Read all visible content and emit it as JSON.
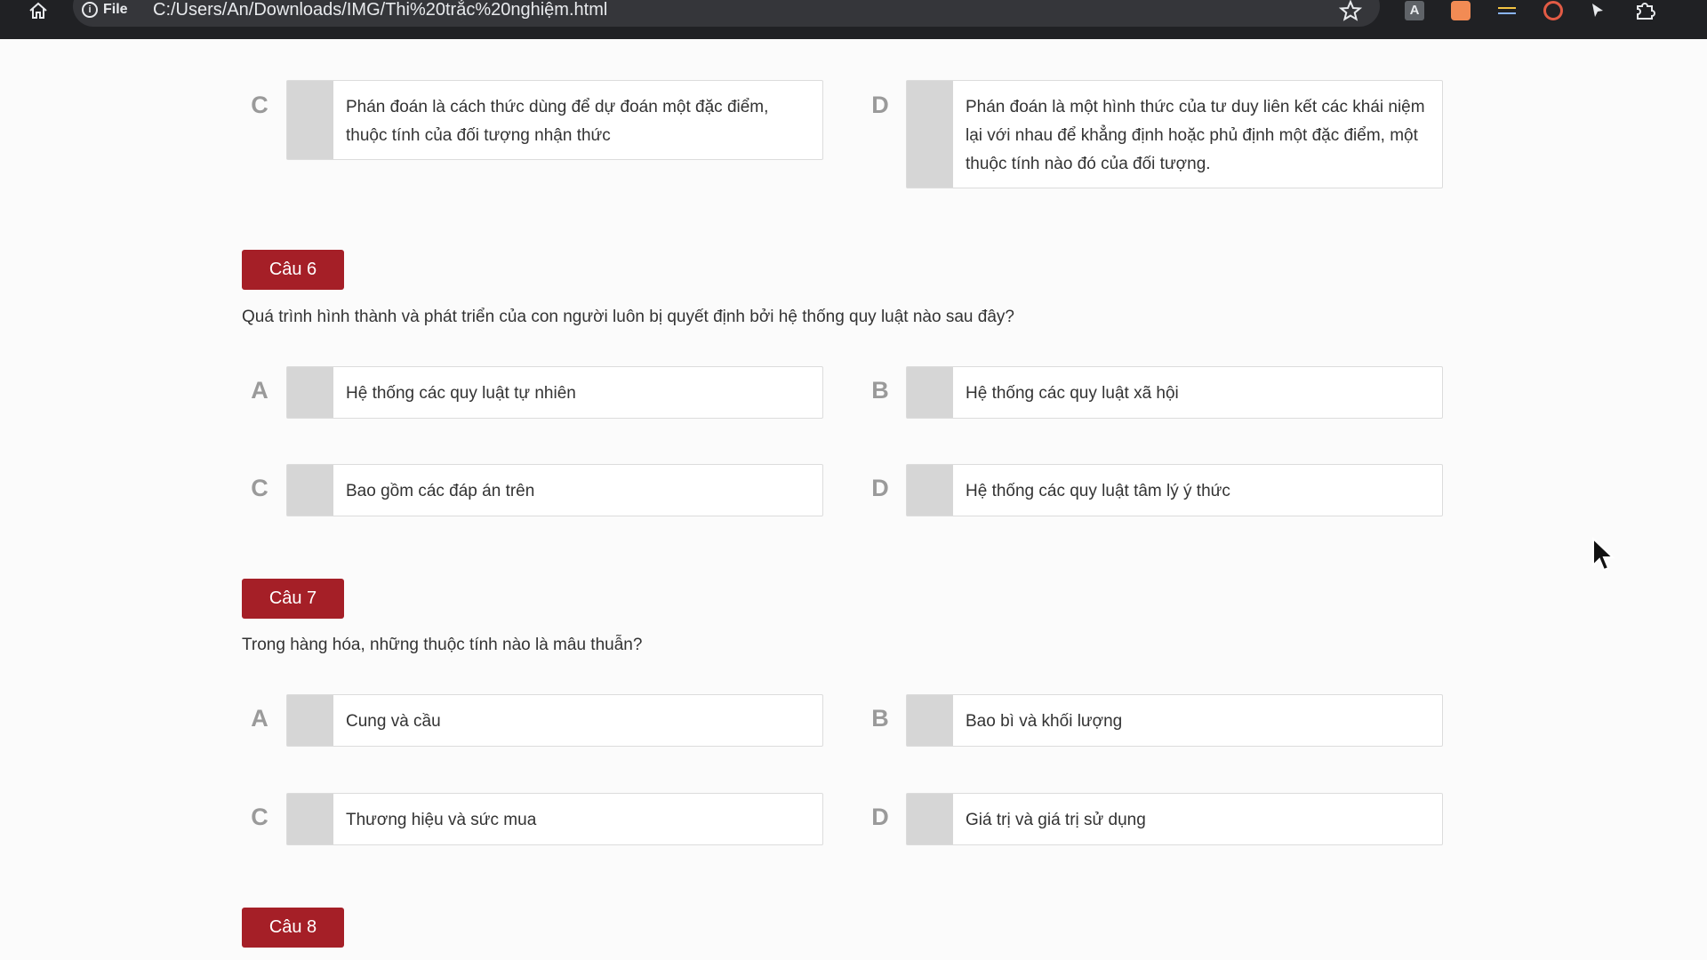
{
  "browser": {
    "site_chip": "File",
    "url": "C:/Users/An/Downloads/IMG/Thi%20trắc%20nghiệm.html",
    "extension_a_label": "A"
  },
  "prev_question": {
    "options": [
      {
        "letter": "C",
        "text": "Phán đoán là cách thức dùng để dự đoán một đặc điểm, thuộc tính của đối tượng nhận thức"
      },
      {
        "letter": "D",
        "text": "Phán đoán là một hình thức của tư duy liên kết các khái niệm lại với nhau để khẳng định hoặc phủ định một đặc điểm, một thuộc tính nào đó của đối tượng."
      }
    ]
  },
  "questions": [
    {
      "label": "Câu 6",
      "text": "Quá trình hình thành và phát triển của con người luôn bị quyết định bởi hệ thống quy luật nào sau đây?",
      "options": [
        {
          "letter": "A",
          "text": "Hệ thống các quy luật tự nhiên"
        },
        {
          "letter": "B",
          "text": "Hệ thống các quy luật xã hội"
        },
        {
          "letter": "C",
          "text": "Bao gồm các đáp án trên"
        },
        {
          "letter": "D",
          "text": "Hệ thống các quy luật tâm lý ý thức"
        }
      ]
    },
    {
      "label": "Câu 7",
      "text": "Trong hàng hóa, những thuộc tính nào là mâu thuẫn?",
      "options": [
        {
          "letter": "A",
          "text": "Cung và cầu"
        },
        {
          "letter": "B",
          "text": "Bao bì và khối lượng"
        },
        {
          "letter": "C",
          "text": "Thương hiệu và sức mua"
        },
        {
          "letter": "D",
          "text": "Giá trị và giá trị sử dụng"
        }
      ]
    },
    {
      "label": "Câu 8"
    }
  ],
  "colors": {
    "badge": "#a51f27",
    "checkbox": "#d6d6d6",
    "letter": "#9a9a9a"
  },
  "icons": [
    "home-icon",
    "info-icon",
    "star-icon",
    "extension-icon",
    "puzzle-icon",
    "mouse-cursor-icon"
  ]
}
